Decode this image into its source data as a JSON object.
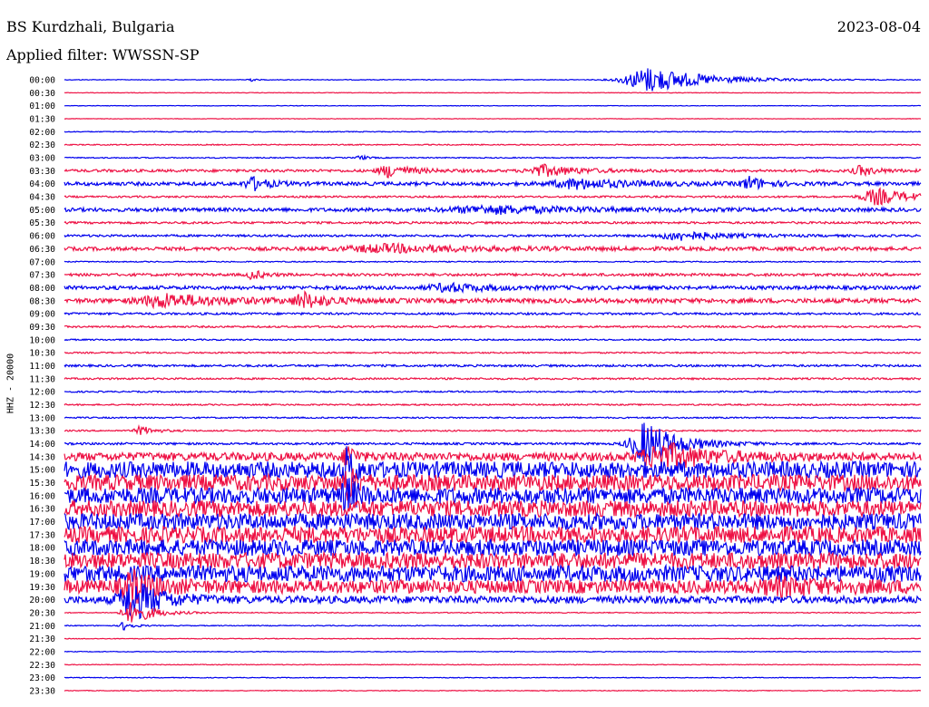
{
  "header": {
    "station": "BS Kurdzhali, Bulgaria",
    "date": "2023-08-04",
    "filter_label": "Applied filter: WWSSN-SP"
  },
  "chart_data": {
    "type": "line",
    "title": "BS Kurdzhali, Bulgaria",
    "ylabel": "HHZ - 20000",
    "colors": [
      "#0000ee",
      "#ee1144"
    ],
    "rows": [
      {
        "label": "00:00",
        "noise": 0.4,
        "events": [
          {
            "x": 0.685,
            "amp": 14,
            "w": 0.05
          },
          {
            "x": 0.215,
            "amp": 3,
            "w": 0.004
          }
        ]
      },
      {
        "label": "00:30",
        "noise": 0.3,
        "events": []
      },
      {
        "label": "01:00",
        "noise": 0.3,
        "events": []
      },
      {
        "label": "01:30",
        "noise": 0.3,
        "events": []
      },
      {
        "label": "02:00",
        "noise": 0.5,
        "events": []
      },
      {
        "label": "02:30",
        "noise": 0.6,
        "events": []
      },
      {
        "label": "03:00",
        "noise": 0.6,
        "events": [
          {
            "x": 0.345,
            "amp": 3,
            "w": 0.006
          }
        ]
      },
      {
        "label": "03:30",
        "noise": 1.5,
        "events": [
          {
            "x": 0.38,
            "amp": 7,
            "w": 0.02
          },
          {
            "x": 0.56,
            "amp": 6,
            "w": 0.03
          },
          {
            "x": 0.93,
            "amp": 5,
            "w": 0.015
          }
        ]
      },
      {
        "label": "04:00",
        "noise": 2.0,
        "events": [
          {
            "x": 0.22,
            "amp": 7,
            "w": 0.015
          },
          {
            "x": 0.6,
            "amp": 5,
            "w": 0.05
          },
          {
            "x": 0.8,
            "amp": 7,
            "w": 0.015
          }
        ]
      },
      {
        "label": "04:30",
        "noise": 1.0,
        "events": [
          {
            "x": 0.95,
            "amp": 9,
            "w": 0.03
          }
        ]
      },
      {
        "label": "05:00",
        "noise": 2.0,
        "events": [
          {
            "x": 0.5,
            "amp": 4,
            "w": 0.08
          }
        ]
      },
      {
        "label": "05:30",
        "noise": 1.2,
        "events": []
      },
      {
        "label": "06:00",
        "noise": 1.2,
        "events": [
          {
            "x": 0.72,
            "amp": 5,
            "w": 0.04
          }
        ]
      },
      {
        "label": "06:30",
        "noise": 2.0,
        "events": [
          {
            "x": 0.38,
            "amp": 4,
            "w": 0.08
          }
        ]
      },
      {
        "label": "07:00",
        "noise": 0.6,
        "events": []
      },
      {
        "label": "07:30",
        "noise": 1.5,
        "events": [
          {
            "x": 0.22,
            "amp": 5,
            "w": 0.01
          }
        ]
      },
      {
        "label": "08:00",
        "noise": 2.0,
        "events": [
          {
            "x": 0.45,
            "amp": 4,
            "w": 0.04
          }
        ]
      },
      {
        "label": "08:30",
        "noise": 2.5,
        "events": [
          {
            "x": 0.12,
            "amp": 7,
            "w": 0.05
          },
          {
            "x": 0.28,
            "amp": 8,
            "w": 0.02
          }
        ]
      },
      {
        "label": "09:00",
        "noise": 1.2,
        "events": []
      },
      {
        "label": "09:30",
        "noise": 1.0,
        "events": []
      },
      {
        "label": "10:00",
        "noise": 0.8,
        "events": []
      },
      {
        "label": "10:30",
        "noise": 0.8,
        "events": []
      },
      {
        "label": "11:00",
        "noise": 1.2,
        "events": []
      },
      {
        "label": "11:30",
        "noise": 1.0,
        "events": []
      },
      {
        "label": "12:00",
        "noise": 0.8,
        "events": []
      },
      {
        "label": "12:30",
        "noise": 0.8,
        "events": []
      },
      {
        "label": "13:00",
        "noise": 0.8,
        "events": []
      },
      {
        "label": "13:30",
        "noise": 0.8,
        "events": [
          {
            "x": 0.09,
            "amp": 5,
            "w": 0.012
          }
        ]
      },
      {
        "label": "14:00",
        "noise": 1.2,
        "events": [
          {
            "x": 0.68,
            "amp": 24,
            "w": 0.03
          }
        ]
      },
      {
        "label": "14:30",
        "noise": 4.5,
        "events": [
          {
            "x": 0.7,
            "amp": 14,
            "w": 0.04
          },
          {
            "x": 0.33,
            "amp": 16,
            "w": 0.006
          }
        ]
      },
      {
        "label": "15:00",
        "noise": 9.0,
        "events": [
          {
            "x": 0.33,
            "amp": 20,
            "w": 0.006
          }
        ]
      },
      {
        "label": "15:30",
        "noise": 9.0,
        "events": [
          {
            "x": 0.33,
            "amp": 18,
            "w": 0.006
          }
        ]
      },
      {
        "label": "16:00",
        "noise": 9.0,
        "events": [
          {
            "x": 0.33,
            "amp": 15,
            "w": 0.01
          }
        ]
      },
      {
        "label": "16:30",
        "noise": 9.0,
        "events": []
      },
      {
        "label": "17:00",
        "noise": 9.0,
        "events": []
      },
      {
        "label": "17:30",
        "noise": 9.0,
        "events": []
      },
      {
        "label": "18:00",
        "noise": 9.0,
        "events": []
      },
      {
        "label": "18:30",
        "noise": 9.0,
        "events": []
      },
      {
        "label": "19:00",
        "noise": 9.0,
        "events": []
      },
      {
        "label": "19:30",
        "noise": 7.5,
        "events": [
          {
            "x": 0.08,
            "amp": 14,
            "w": 0.02
          },
          {
            "x": 0.84,
            "amp": 6,
            "w": 0.04
          }
        ]
      },
      {
        "label": "20:00",
        "noise": 4.0,
        "events": [
          {
            "x": 0.08,
            "amp": 22,
            "w": 0.025
          }
        ]
      },
      {
        "label": "20:30",
        "noise": 0.5,
        "events": [
          {
            "x": 0.08,
            "amp": 12,
            "w": 0.02
          }
        ]
      },
      {
        "label": "21:00",
        "noise": 0.5,
        "events": [
          {
            "x": 0.07,
            "amp": 5,
            "w": 0.008
          }
        ]
      },
      {
        "label": "21:30",
        "noise": 0.4,
        "events": []
      },
      {
        "label": "22:00",
        "noise": 0.4,
        "events": []
      },
      {
        "label": "22:30",
        "noise": 0.4,
        "events": []
      },
      {
        "label": "23:00",
        "noise": 0.4,
        "events": []
      },
      {
        "label": "23:30",
        "noise": 0.4,
        "events": []
      }
    ]
  }
}
